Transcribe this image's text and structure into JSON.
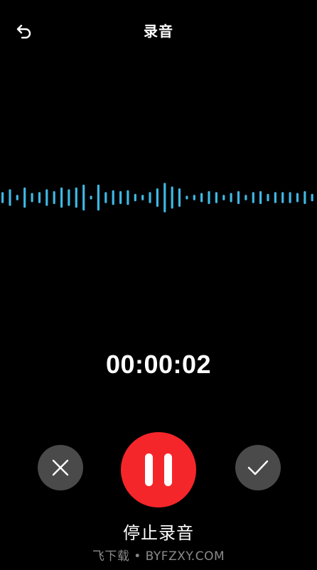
{
  "header": {
    "title": "录音",
    "back_icon": "undo-arrow-icon"
  },
  "timer": "00:00:02",
  "controls": {
    "cancel_icon": "close-icon",
    "pause_icon": "pause-icon",
    "confirm_icon": "checkmark-icon",
    "stop_label": "停止录音"
  },
  "watermark": "飞下载 • BYFZXY.COM",
  "colors": {
    "background": "#000000",
    "waveform": "#3fb8e4",
    "record_button": "#f5262a",
    "side_button": "#4a4a4a"
  },
  "waveform_levels": [
    0.3,
    0.45,
    0.15,
    0.55,
    0.25,
    0.3,
    0.45,
    0.35,
    0.55,
    0.45,
    0.55,
    0.7,
    0.1,
    0.7,
    0.3,
    0.4,
    0.35,
    0.4,
    0.2,
    0.15,
    0.3,
    0.5,
    0.8,
    0.6,
    0.5,
    0.1,
    0.15,
    0.25,
    0.35,
    0.3,
    0.15,
    0.25,
    0.35,
    0.15,
    0.3,
    0.35,
    0.2,
    0.3,
    0.3,
    0.3,
    0.25,
    0.35,
    0.2
  ]
}
